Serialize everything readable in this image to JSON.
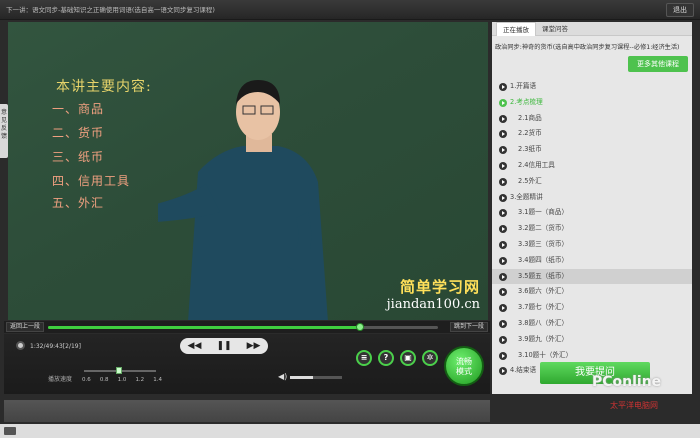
{
  "topbar": {
    "title": "下一讲：语文同步-基础知识之正确使用词语(选自高一语文同步复习课程)",
    "exit_label": "退出"
  },
  "feedback_tab": "意见反馈",
  "video": {
    "board_heading": "本讲主要内容:",
    "board_items": [
      "一、商品",
      "二、货币",
      "三、纸币",
      "四、信用工具",
      "五、外汇"
    ],
    "watermark_line1": "简单学习网",
    "watermark_line2": "jiandan100.cn"
  },
  "progress": {
    "back_label": "返回上一段",
    "skip_label": "跳到下一段",
    "fraction": 0.8
  },
  "controls": {
    "time": "1:32/49:43[2/19]",
    "prev_icon": "rewind-icon",
    "pause_icon": "pause-icon",
    "next_icon": "fast-forward-icon",
    "speed_label": "播放速度",
    "speed_ticks": [
      "0.6",
      "0.8",
      "1.0",
      "1.2",
      "1.4"
    ],
    "speed_value": "1.0",
    "volume_fraction": 0.45,
    "smooth_label_1": "流畅",
    "smooth_label_2": "模式",
    "icon_buttons": [
      "list-icon",
      "help-icon",
      "notes-icon",
      "settings-icon"
    ]
  },
  "panel": {
    "tabs": [
      "正在播放",
      "课堂问答"
    ],
    "course_desc": "政治同步:神奇的货币(选自高中政治同步复习课程--必修1:经济生活)",
    "more_button": "更多其他课程",
    "chapters": [
      {
        "label": "1.开篇语",
        "level": 1
      },
      {
        "label": "2.考点梳理",
        "level": 1,
        "playing": true
      },
      {
        "label": "2.1商品",
        "level": 2
      },
      {
        "label": "2.2货币",
        "level": 2
      },
      {
        "label": "2.3纸币",
        "level": 2
      },
      {
        "label": "2.4信用工具",
        "level": 2
      },
      {
        "label": "2.5外汇",
        "level": 2
      },
      {
        "label": "3.全题精讲",
        "level": 1
      },
      {
        "label": "3.1题一（商品）",
        "level": 2
      },
      {
        "label": "3.2题二（货币）",
        "level": 2
      },
      {
        "label": "3.3题三（货币）",
        "level": 2
      },
      {
        "label": "3.4题四（纸币）",
        "level": 2
      },
      {
        "label": "3.5题五（纸币）",
        "level": 2,
        "active": true
      },
      {
        "label": "3.6题六（外汇）",
        "level": 2
      },
      {
        "label": "3.7题七（外汇）",
        "level": 2
      },
      {
        "label": "3.8题八（外汇）",
        "level": 2
      },
      {
        "label": "3.9题九（外汇）",
        "level": 2
      },
      {
        "label": "3.10题十（外汇）",
        "level": 2
      },
      {
        "label": "4.结束语",
        "level": 1
      }
    ],
    "ask_button": "我要提问"
  },
  "watermark_logo": "PConline",
  "watermark_logo_sub": "太平洋电脑网",
  "colors": {
    "accent": "#4ec24e",
    "panel_bg": "#e7e7e7",
    "board": "#2f4f3a"
  }
}
